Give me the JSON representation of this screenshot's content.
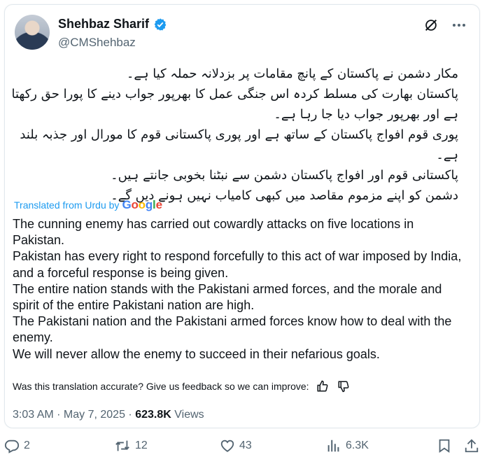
{
  "author": {
    "name": "Shehbaz Sharif",
    "handle": "@CMShehbaz"
  },
  "tweet": {
    "urdu_lines": [
      "مکار دشمن نے پاکستان کے پانچ مقامات پر بزدلانہ حملہ کیا ہے۔",
      "پاکستان بھارت کی مسلط کردہ اس جنگی عمل کا بھرپور جواب دینے کا پورا حق رکھتا",
      "ہے اور بھرپور جواب دیا جا رہا ہے۔",
      "پوری قوم افواج پاکستان کے ساتھ ہے اور پوری پاکستانی قوم کا مورال اور جذبہ بلند",
      "ہے۔",
      "پاکستانی قوم اور افواج پاکستان دشمن سے نبٹنا بخوبی جانتے ہیں۔",
      "دشمن کو اپنے مزموم مقاصد میں کبھی کامیاب نہیں ہونے دیں گے۔"
    ],
    "translated_label": "Translated from Urdu by",
    "google": [
      "G",
      "o",
      "o",
      "g",
      "l",
      "e"
    ],
    "english_paragraphs": [
      "The cunning enemy has carried out cowardly attacks on five locations in Pakistan.",
      "Pakistan has every right to respond forcefully to this act of war imposed by India, and a forceful response is being given.",
      "The entire nation stands with the Pakistani armed forces, and the morale and spirit of the entire Pakistani nation are high.",
      "The Pakistani nation and the Pakistani armed forces know how to deal with the enemy.",
      "We will never allow the enemy to succeed in their nefarious goals."
    ],
    "feedback_prompt": "Was this translation accurate? Give us feedback so we can improve:",
    "time": "3:03 AM · May 7, 2025 ·",
    "views_count": "623.8K",
    "views_label": "Views"
  },
  "actions": {
    "replies": "2",
    "reposts": "12",
    "likes": "43",
    "views": "6.3K"
  },
  "colors": {
    "accent": "#1d9bf0",
    "secondary_text": "#536471",
    "primary_text": "#0f1419"
  }
}
